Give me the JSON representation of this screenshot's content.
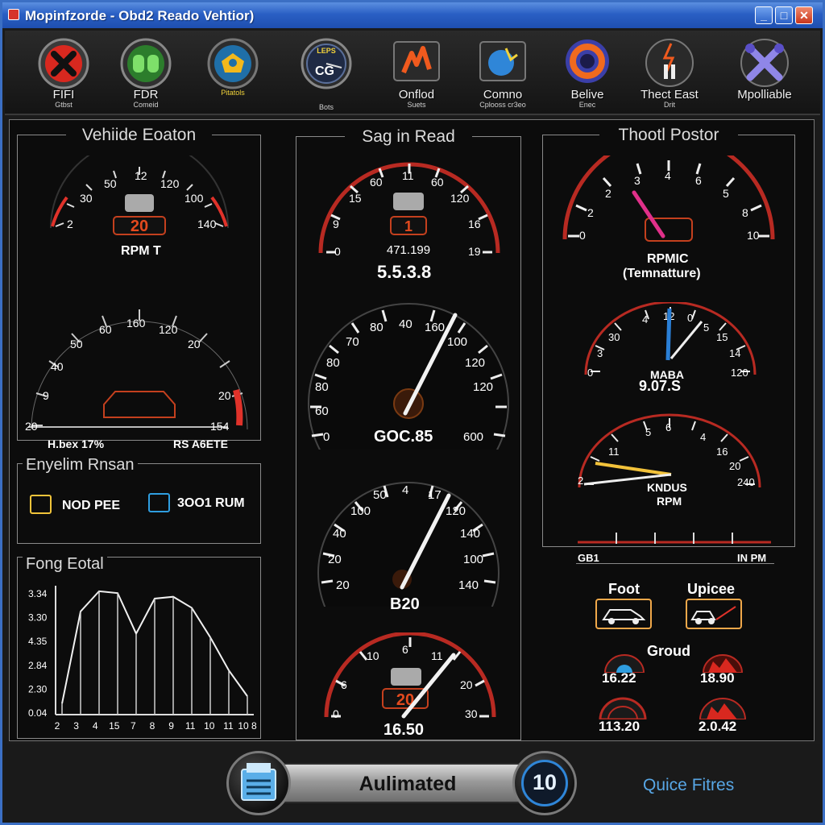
{
  "window": {
    "title": "Mopinfzorde - Obd2 Readο Vehtior)"
  },
  "toolbar": {
    "items": [
      {
        "label": "FIFI",
        "sub": "Gtbst",
        "icon": "error-x-icon"
      },
      {
        "label": "FDR",
        "sub": "Comeid",
        "icon": "engine-icon"
      },
      {
        "label": "",
        "sub": "Pitatols",
        "icon": "robot-tool-icon"
      },
      {
        "label": "",
        "sub": "Bots",
        "icon": "gauge-cg-icon",
        "badge": "CG",
        "badge_top": "LEPS"
      },
      {
        "label": "Onflod",
        "sub": "Suets",
        "icon": "circuit-fire-icon"
      },
      {
        "label": "Comno",
        "sub": "Cplooss cr3eo",
        "icon": "network-spark-icon"
      },
      {
        "label": "Belive",
        "sub": "Enec",
        "icon": "refresh-ring-icon"
      },
      {
        "label": "Thect East",
        "sub": "Drit",
        "icon": "flash-key-icon"
      },
      {
        "label": "Mpolliable",
        "sub": "",
        "icon": "wrench-cross-icon"
      }
    ]
  },
  "left_panel": {
    "title": "Vehiide Eoaton",
    "gauge1": {
      "ticks": [
        "2",
        "30",
        "50",
        "12",
        "120",
        "100",
        "140"
      ],
      "display": "20",
      "label": "RPM T"
    },
    "gauge2": {
      "ticks": [
        "20",
        "9",
        "40",
        "50",
        "60",
        "160",
        "120",
        "20",
        "20",
        "154"
      ]
    },
    "footer_left": "H.bex 17%",
    "footer_right": "RS A6ETE",
    "engine_box": {
      "title": "Enyelim Rnsan",
      "item1": "NOD PEE",
      "item2": "3OO1 RUM"
    },
    "fuel_chart": {
      "title": "Fong Eotal",
      "yticks": [
        "3.34",
        "3.30",
        "4.35",
        "2.84",
        "2.30",
        "0.04"
      ],
      "xticks": [
        "2",
        "3",
        "4",
        "15",
        "7",
        "8",
        "9",
        "11",
        "10",
        "11",
        "10 8"
      ]
    }
  },
  "chart_data": {
    "type": "line",
    "title": "Fong Eotal",
    "x": [
      2,
      3,
      4,
      15,
      7,
      8,
      9,
      11,
      10,
      11,
      10
    ],
    "series": [
      {
        "values": [
          0.3,
          2.8,
          3.35,
          3.3,
          2.2,
          3.15,
          3.2,
          2.9,
          2.1,
          1.2,
          0.5
        ]
      }
    ],
    "ylim": [
      0,
      3.5
    ]
  },
  "center_panel": {
    "title": "Sag in Read",
    "gauge1": {
      "ticks": [
        "0",
        "9",
        "15",
        "60",
        "11",
        "60",
        "120",
        "16",
        "19"
      ],
      "display": "1",
      "reading": "471.199",
      "value": "5.5.3.8"
    },
    "gauge2": {
      "ticks": [
        "0",
        "60",
        "80",
        "80",
        "70",
        "80",
        "40",
        "160",
        "100",
        "120",
        "120",
        "600"
      ],
      "value": "GOC.85"
    },
    "gauge3": {
      "ticks": [
        "20",
        "20",
        "40",
        "100",
        "50",
        "4",
        "17",
        "120",
        "140",
        "100",
        "140"
      ],
      "value": "B20"
    },
    "gauge4": {
      "ticks": [
        "0",
        "6",
        "10",
        "6",
        "11",
        "20",
        "30"
      ],
      "display": "20",
      "value": "16.50"
    }
  },
  "right_panel": {
    "title": "Thootl Postor",
    "gauge1": {
      "ticks": [
        "0",
        "2",
        "2",
        "3",
        "4",
        "6",
        "5",
        "8",
        "10"
      ],
      "label1": "RPMIC",
      "label2": "(Temnatture)"
    },
    "gauge2": {
      "ticks": [
        "0",
        "3",
        "30",
        "4",
        "12",
        "0",
        "5",
        "15",
        "14",
        "120"
      ],
      "label": "MABA",
      "value": "9.07.S"
    },
    "gauge3": {
      "ticks": [
        "2",
        "11",
        "5",
        "6",
        "4",
        "16",
        "20",
        "240"
      ],
      "label1": "KNDUS",
      "label2": "RPM"
    },
    "strip_left": "GB1",
    "strip_right": "IN PM",
    "foot_label": "Foot",
    "upicee_label": "Upicee",
    "groud_label": "Groud",
    "readings": [
      "16.22",
      "18.90",
      "113.20",
      "2.0.42"
    ]
  },
  "bottom": {
    "center_label": "Aulimated",
    "counter": "10",
    "link": "Quice Fitres"
  },
  "colors": {
    "accent_red": "#e0322a",
    "needle": "#f2f2f2",
    "pink_needle": "#e0308a",
    "blue_needle": "#2a7fd6",
    "link_blue": "#58a7e6"
  }
}
